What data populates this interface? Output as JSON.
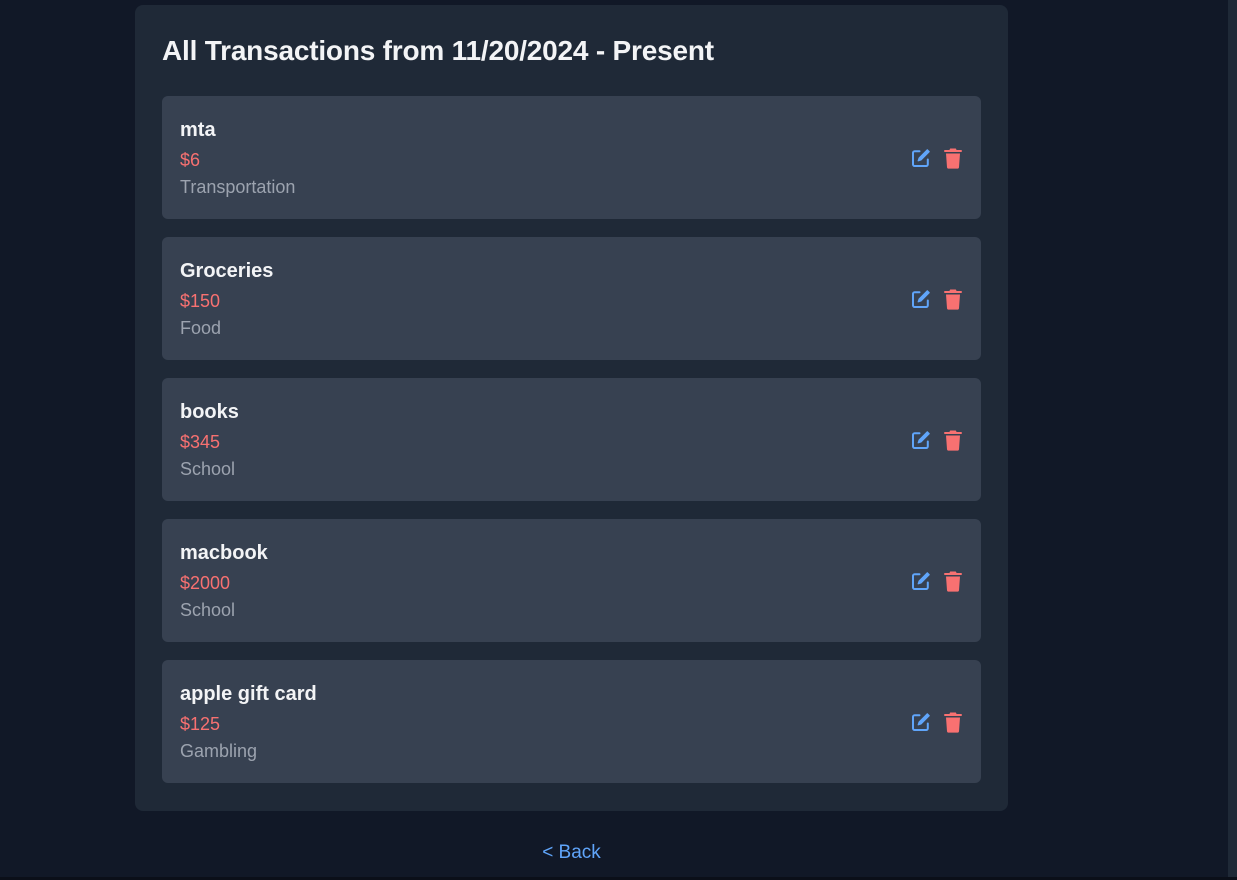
{
  "page": {
    "title": "All Transactions from 11/20/2024 - Present",
    "back_label": "< Back"
  },
  "colors": {
    "background": "#111827",
    "panel": "#1f2937",
    "card": "#374151",
    "amount": "#f87171",
    "edit_icon": "#60a5fa",
    "delete_icon": "#f87171",
    "category_text": "#9ca3af"
  },
  "icons": {
    "edit": "edit-icon",
    "delete": "trash-icon"
  },
  "transactions": [
    {
      "name": "mta",
      "amount": "$6",
      "category": "Transportation"
    },
    {
      "name": "Groceries",
      "amount": "$150",
      "category": "Food"
    },
    {
      "name": "books",
      "amount": "$345",
      "category": "School"
    },
    {
      "name": "macbook",
      "amount": "$2000",
      "category": "School"
    },
    {
      "name": "apple gift card",
      "amount": "$125",
      "category": "Gambling"
    }
  ]
}
